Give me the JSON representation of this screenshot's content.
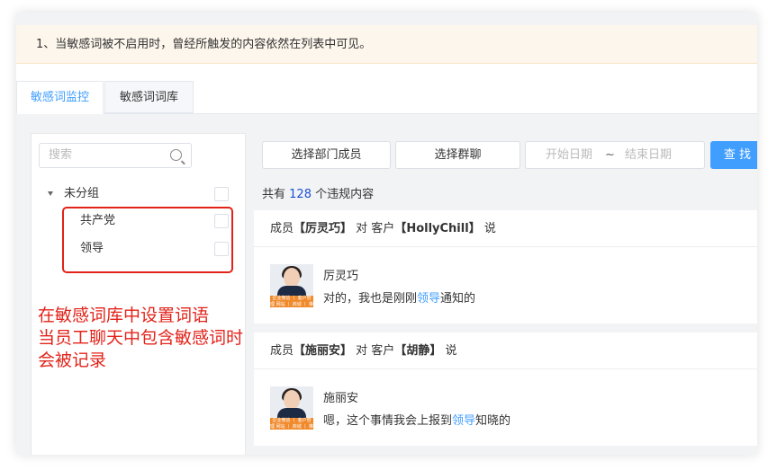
{
  "notice": "1、当敏感词被不启用时，曾经所触发的内容依然在列表中可见。",
  "tabs": [
    {
      "label": "敏感词监控",
      "active": true
    },
    {
      "label": "敏感词词库",
      "active": false
    }
  ],
  "sidebar": {
    "search_placeholder": "搜索",
    "tree": [
      {
        "label": "未分组",
        "level": 0
      },
      {
        "label": "共产党",
        "level": 1
      },
      {
        "label": "领导",
        "level": 1
      }
    ]
  },
  "annotation": [
    "在敏感词库中设置词语",
    "当员工聊天中包含敏感词时",
    "会被记录"
  ],
  "toolbar": {
    "select_members": "选择部门成员",
    "select_groups": "选择群聊",
    "start_date": "开始日期",
    "range_sep": "~",
    "end_date": "结束日期",
    "search_button": "查 找"
  },
  "summary": {
    "prefix": "共有",
    "count": "128",
    "suffix": "个违规内容"
  },
  "messages": [
    {
      "header": {
        "member_label": "成员",
        "member": "【厉灵巧】",
        "to": "对 客户",
        "customer": "【HollyChill】",
        "says": "说"
      },
      "avatar_banner": "企业微信 丨 客户管理 网站 丨 商城 丨 推广",
      "name": "厉灵巧",
      "text_before": "对的，我也是刚刚",
      "keyword": "领导",
      "text_after": "通知的"
    },
    {
      "header": {
        "member_label": "成员",
        "member": "【施丽安】",
        "to": "对 客户",
        "customer": "【胡静】",
        "says": "说"
      },
      "avatar_banner": "企业微信 丨 客户管理 网站 丨 商城 丨 推广",
      "name": "施丽安",
      "text_before": "嗯，这个事情我会上报到",
      "keyword": "领导",
      "text_after": "知晓的"
    }
  ],
  "colors": {
    "accent": "#409eff",
    "annotation_red": "#e2231a",
    "notice_bg": "#fdf6ec"
  }
}
